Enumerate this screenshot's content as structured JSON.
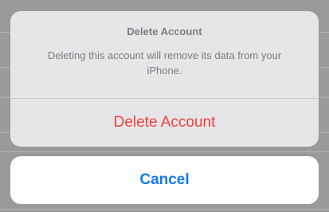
{
  "action_sheet": {
    "title": "Delete Account",
    "message": "Deleting this account will remove its data from your iPhone.",
    "destructive_label": "Delete Account",
    "cancel_label": "Cancel"
  },
  "colors": {
    "destructive": "#f0413a",
    "cancel": "#1479f5",
    "sheet_background": "#e6e6e9",
    "dimmed_backdrop": "#9a9a9c"
  }
}
